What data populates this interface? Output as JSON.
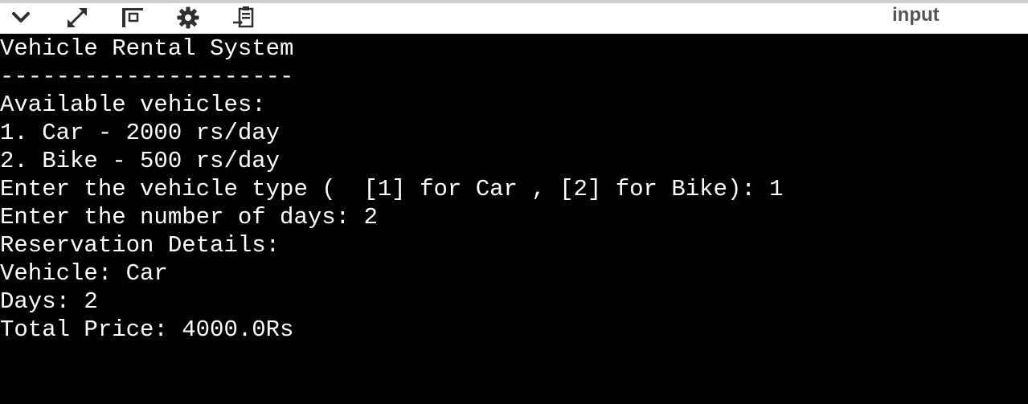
{
  "toolbar": {
    "icons": [
      "chevron-down-icon",
      "expand-icon",
      "layout-icon",
      "gear-icon",
      "clipboard-paste-icon"
    ],
    "right_label": "input"
  },
  "console": {
    "lines": [
      "Vehicle Rental System",
      "---------------------",
      "Available vehicles:",
      "1. Car - 2000 rs/day",
      "2. Bike - 500 rs/day",
      "Enter the vehicle type (  [1] for Car , [2] for Bike): 1",
      "Enter the number of days: 2",
      "Reservation Details:",
      "Vehicle: Car",
      "Days: 2",
      "Total Price: 4000.0Rs"
    ]
  },
  "colors": {
    "toolbar_bg": "#ffffff",
    "console_bg": "#000000",
    "console_text": "#ffffff",
    "icon": "#3a3a3a",
    "label": "#555555"
  }
}
